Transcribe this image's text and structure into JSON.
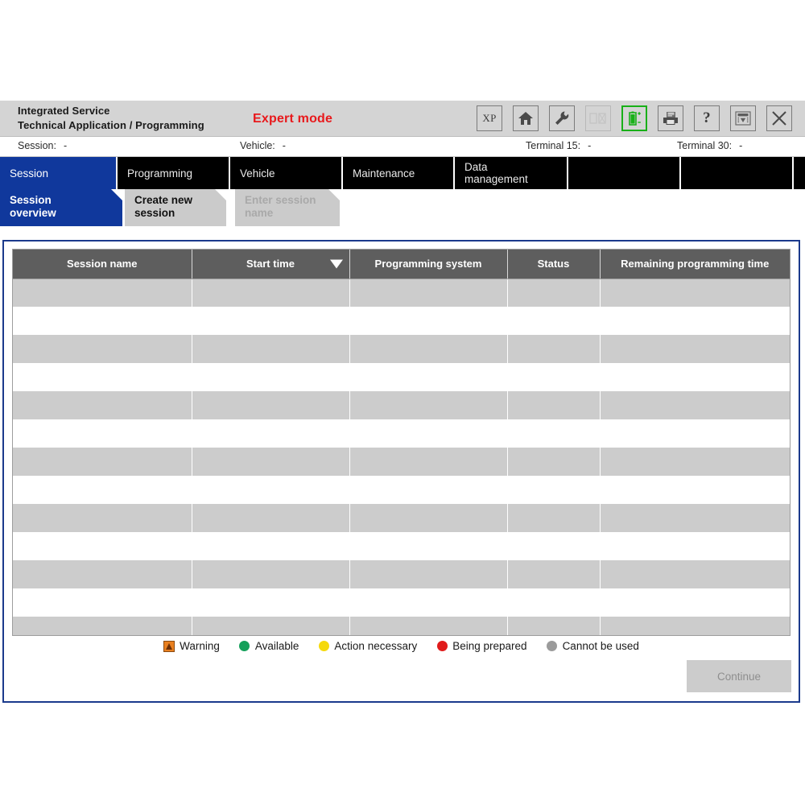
{
  "header": {
    "title_line1": "Integrated Service",
    "title_line2": "Technical Application / Programming",
    "mode_label": "Expert mode",
    "mode_color": "#e8191c"
  },
  "toolbar": {
    "buttons": [
      {
        "name": "xp-mode-button",
        "label": "XP",
        "icon": "xp-text",
        "state": "enabled"
      },
      {
        "name": "home-button",
        "label": "",
        "icon": "home-icon",
        "state": "enabled"
      },
      {
        "name": "settings-button",
        "label": "",
        "icon": "wrench-icon",
        "state": "enabled"
      },
      {
        "name": "measure-button",
        "label": "",
        "icon": "two-boxes-icon",
        "state": "disabled"
      },
      {
        "name": "battery-status-button",
        "label": "",
        "icon": "battery-icon",
        "state": "active"
      },
      {
        "name": "print-button",
        "label": "",
        "icon": "printer-icon",
        "state": "enabled"
      },
      {
        "name": "help-button",
        "label": "?",
        "icon": "question-mark-icon",
        "state": "enabled"
      },
      {
        "name": "minimize-button",
        "label": "",
        "icon": "dropdown-panel-icon",
        "state": "enabled"
      },
      {
        "name": "close-button",
        "label": "",
        "icon": "close-x-icon",
        "state": "enabled"
      }
    ],
    "accent_active": "#18b018"
  },
  "status": {
    "session_label": "Session:",
    "session_value": "-",
    "vehicle_label": "Vehicle:",
    "vehicle_value": "-",
    "terminal15_label": "Terminal 15:",
    "terminal15_value": "-",
    "terminal30_label": "Terminal 30:",
    "terminal30_value": "-"
  },
  "mainnav": {
    "active_color": "#10389c",
    "tabs": [
      {
        "label": "Session",
        "active": true
      },
      {
        "label": "Programming",
        "active": false
      },
      {
        "label": "Vehicle",
        "active": false
      },
      {
        "label": "Maintenance",
        "active": false
      },
      {
        "label": "Data\nmanagement",
        "line1": "Data",
        "line2": "management",
        "active": false
      },
      {
        "label": "",
        "active": false
      },
      {
        "label": "",
        "active": false
      }
    ]
  },
  "subnav": {
    "tabs": [
      {
        "line1": "Session",
        "line2": "overview",
        "state": "active"
      },
      {
        "line1": "Create new",
        "line2": "session",
        "state": "enabled"
      },
      {
        "line1": "Enter session",
        "line2": "name",
        "state": "disabled"
      }
    ]
  },
  "table": {
    "columns": [
      {
        "label": "Session name",
        "sort": "none"
      },
      {
        "label": "Start time",
        "sort": "desc"
      },
      {
        "label": "Programming system",
        "sort": "none"
      },
      {
        "label": "Status",
        "sort": "none"
      },
      {
        "label": "Remaining programming time",
        "sort": "none"
      }
    ],
    "rows": [],
    "empty_row_count": 13
  },
  "legend": {
    "items": [
      {
        "label": "Warning",
        "color": "#e98020",
        "shape": "warning-triangle"
      },
      {
        "label": "Available",
        "color": "#14a05a",
        "shape": "circle"
      },
      {
        "label": "Action necessary",
        "color": "#f5d90a",
        "shape": "circle"
      },
      {
        "label": "Being prepared",
        "color": "#e01b1b",
        "shape": "circle"
      },
      {
        "label": "Cannot be used",
        "color": "#9b9b9b",
        "shape": "circle"
      }
    ]
  },
  "footer": {
    "continue_label": "Continue",
    "continue_state": "disabled"
  }
}
